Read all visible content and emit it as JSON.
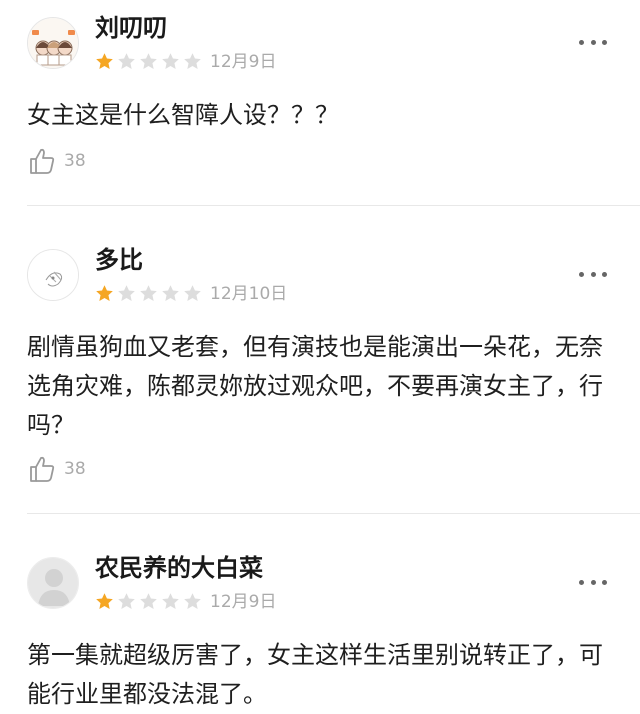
{
  "reviews": [
    {
      "username": "刘叨叨",
      "rating": 1,
      "max_rating": 5,
      "date": "12月9日",
      "content": "女主这是什么智障人设？？？",
      "likes": "38"
    },
    {
      "username": "多比",
      "rating": 1,
      "max_rating": 5,
      "date": "12月10日",
      "content": "剧情虽狗血又老套，但有演技也是能演出一朵花，无奈选角灾难，陈都灵妳放过观众吧，不要再演女主了，行吗？",
      "likes": "38"
    },
    {
      "username": "农民养的大白菜",
      "rating": 1,
      "max_rating": 5,
      "date": "12月9日",
      "content": "第一集就超级厉害了，女主这样生活里别说转正了，可能行业里都没法混了。",
      "likes": ""
    }
  ],
  "colors": {
    "star_filled": "#f5a623",
    "star_empty": "#dddddd",
    "divider": "#e8e8e8",
    "muted_text": "#aaaaaa"
  },
  "icons": {
    "more": "more-dots-icon",
    "like": "thumbs-up-icon",
    "star": "star-icon"
  }
}
